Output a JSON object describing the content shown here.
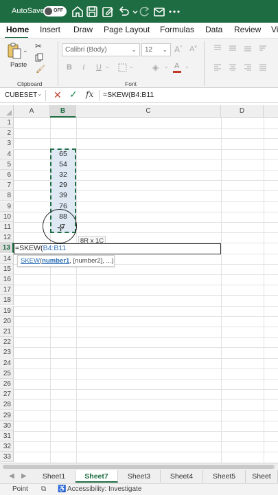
{
  "titlebar": {
    "autosave_label": "AutoSave",
    "toggle_state": "OFF",
    "icons": [
      "home-icon",
      "save-icon",
      "edit-icon",
      "undo-icon",
      "redo-icon",
      "mail-icon",
      "more-icon"
    ]
  },
  "ribbon_tabs": [
    "Home",
    "Insert",
    "Draw",
    "Page Layout",
    "Formulas",
    "Data",
    "Review",
    "Vi"
  ],
  "ribbon": {
    "paste_label": "Paste",
    "clipboard_label": "Clipboard",
    "font_name": "Calibri (Body)",
    "font_size": "12",
    "font_label": "Font",
    "bold": "B",
    "italic": "I",
    "underline": "U"
  },
  "formula_bar": {
    "name_box": "CUBESET",
    "fx": "fx",
    "formula": "=SKEW(B4:B11"
  },
  "grid": {
    "columns": [
      "A",
      "B",
      "C",
      "D"
    ],
    "rows": [
      "1",
      "2",
      "3",
      "4",
      "5",
      "6",
      "7",
      "8",
      "9",
      "10",
      "11",
      "12",
      "13",
      "14",
      "15",
      "16",
      "17",
      "18",
      "19",
      "20",
      "21",
      "22",
      "23",
      "24",
      "25",
      "26",
      "27",
      "28",
      "29",
      "30",
      "31",
      "32",
      "33"
    ],
    "b_values": [
      "65",
      "54",
      "32",
      "29",
      "39",
      "76",
      "88",
      "7"
    ],
    "edit_prefix": "=SKEW(",
    "edit_ref": "B4:B11",
    "size_tooltip": "8R x 1C",
    "hint_fn": "SKEW",
    "hint_open": "(",
    "hint_arg": "number1",
    "hint_rest": ", [number2], ...)"
  },
  "sheets": [
    "Sheet1",
    "Sheet7",
    "Sheet3",
    "Sheet4",
    "Sheet5",
    "Sheet"
  ],
  "active_sheet": "Sheet7",
  "status": {
    "mode": "Point",
    "accessibility": "Accessibility: Investigate"
  },
  "colors": {
    "brand": "#1e6c41",
    "selection_fill": "#dfe9f4",
    "reference_blue": "#2c6eb5"
  }
}
